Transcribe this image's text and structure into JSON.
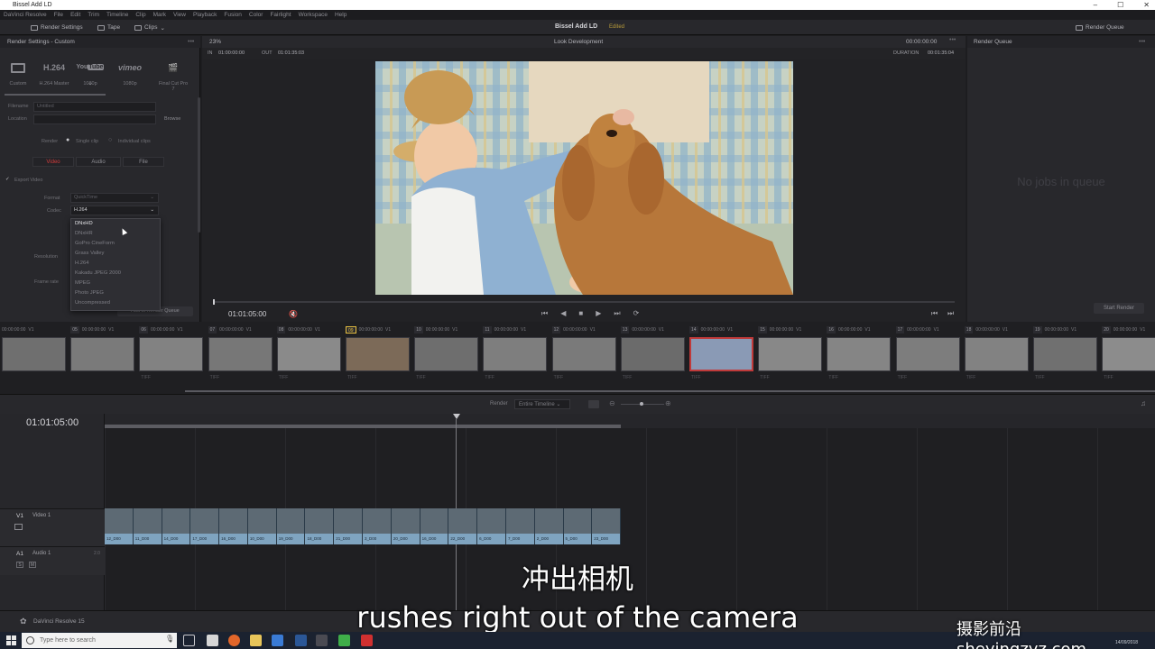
{
  "window": {
    "title": "Bissel Add LD"
  },
  "menu": [
    "DaVinci Resolve",
    "File",
    "Edit",
    "Trim",
    "Timeline",
    "Clip",
    "Mark",
    "View",
    "Playback",
    "Fusion",
    "Color",
    "Fairlight",
    "Workspace",
    "Help"
  ],
  "toolbar": {
    "render_settings": "Render Settings",
    "tape": "Tape",
    "clips": "Clips",
    "project_title": "Bissel Add LD",
    "project_status": "Edited",
    "render_queue": "Render Queue"
  },
  "left_panel": {
    "header": "Render Settings - Custom",
    "presets": [
      {
        "logo": "",
        "label": "Custom"
      },
      {
        "logo": "H.264",
        "label": "H.264 Master"
      },
      {
        "logo": "YouTube",
        "label": "1080p"
      },
      {
        "logo": "vimeo",
        "label": "1080p"
      },
      {
        "logo": "",
        "label": "Final Cut Pro 7"
      }
    ],
    "filename_label": "Filename",
    "filename_value": "Untitled",
    "location_label": "Location",
    "browse": "Browse",
    "render_label": "Render",
    "single_clip": "Single clip",
    "individual_clips": "Individual clips",
    "tabs": [
      "Video",
      "Audio",
      "File"
    ],
    "export_video": "Export Video",
    "format_label": "Format",
    "format_value": "QuickTime",
    "codec_label": "Codec",
    "codec_value": "H.264",
    "resolution_label": "Resolution",
    "frame_rate_label": "Frame rate",
    "add_to_queue": "Add to Render Queue",
    "codec_options": [
      "DNxHD",
      "DNxHR",
      "GoPro CineForm",
      "Grass Valley",
      "H.264",
      "Kakadu JPEG 2000",
      "MPEG",
      "Photo JPEG",
      "Uncompressed"
    ],
    "codec_highlighted": "DNxHD"
  },
  "viewer": {
    "zoom": "23%",
    "mode": "Look Development",
    "timecode_top": "00:00:00:00",
    "in_label": "IN",
    "in_value": "01:00:00:00",
    "out_label": "OUT",
    "out_value": "01:01:35:03",
    "duration_label": "DURATION",
    "duration_value": "00:01:35:04",
    "current_timecode": "01:01:05:00"
  },
  "render_queue": {
    "header": "Render Queue",
    "empty_text": "No jobs in queue",
    "start_render": "Start Render"
  },
  "clips": [
    {
      "num": "",
      "tc": "00:00:00:00",
      "track": "V1",
      "codec": ""
    },
    {
      "num": "05",
      "tc": "00:00:00:00",
      "track": "V1",
      "codec": ""
    },
    {
      "num": "06",
      "tc": "00:00:00:00",
      "track": "V1",
      "codec": "TIFF"
    },
    {
      "num": "07",
      "tc": "00:00:00:00",
      "track": "V1",
      "codec": "TIFF"
    },
    {
      "num": "08",
      "tc": "00:00:00:00",
      "track": "V1",
      "codec": "TIFF"
    },
    {
      "num": "09",
      "tc": "00:00:00:00",
      "track": "V1",
      "codec": "TIFF"
    },
    {
      "num": "10",
      "tc": "00:00:00:00",
      "track": "V1",
      "codec": "TIFF"
    },
    {
      "num": "11",
      "tc": "00:00:00:00",
      "track": "V1",
      "codec": "TIFF"
    },
    {
      "num": "12",
      "tc": "00:00:00:00",
      "track": "V1",
      "codec": "TIFF"
    },
    {
      "num": "13",
      "tc": "00:00:00:00",
      "track": "V1",
      "codec": "TIFF"
    },
    {
      "num": "14",
      "tc": "00:00:00:00",
      "track": "V1",
      "codec": "TIFF"
    },
    {
      "num": "15",
      "tc": "00:00:00:00",
      "track": "V1",
      "codec": "TIFF"
    },
    {
      "num": "16",
      "tc": "00:00:00:00",
      "track": "V1",
      "codec": "TIFF"
    },
    {
      "num": "17",
      "tc": "00:00:00:00",
      "track": "V1",
      "codec": "TIFF"
    },
    {
      "num": "18",
      "tc": "00:00:00:00",
      "track": "V1",
      "codec": "TIFF"
    },
    {
      "num": "19",
      "tc": "00:00:00:00",
      "track": "V1",
      "codec": "TIFF"
    },
    {
      "num": "20",
      "tc": "00:00:00:00",
      "track": "V1",
      "codec": "TIFF"
    }
  ],
  "timeline": {
    "render_label": "Render",
    "render_select": "Entire Timeline",
    "timecode": "01:01:05:00",
    "v1_label": "V1",
    "v1_name": "Video 1",
    "a1_label": "A1",
    "a1_name": "Audio 1",
    "a1_level": "2.0",
    "clip_names": [
      "12_D00",
      "11_D00",
      "14_D00",
      "17_D00",
      "16_D00",
      "10_D00",
      "19_D00",
      "18_D00",
      "21_D00",
      "3_D00",
      "20_D00",
      "16_D00",
      "22_D00",
      "6_D00",
      "7_D00",
      "2_D00",
      "5_D00",
      "23_D00"
    ]
  },
  "footer": {
    "brand": "DaVinci Resolve 15"
  },
  "taskbar": {
    "search_placeholder": "Type here to search",
    "date": "14/09/2018"
  },
  "subtitles": {
    "cn": "冲出相机",
    "en": "rushes right out of the camera"
  },
  "watermark": "摄影前沿 sheyingzyz.com",
  "colors": {
    "accent_red": "#c03a3a",
    "clip_blue": "#7fa4c0",
    "status_gold": "#b89b3a"
  }
}
